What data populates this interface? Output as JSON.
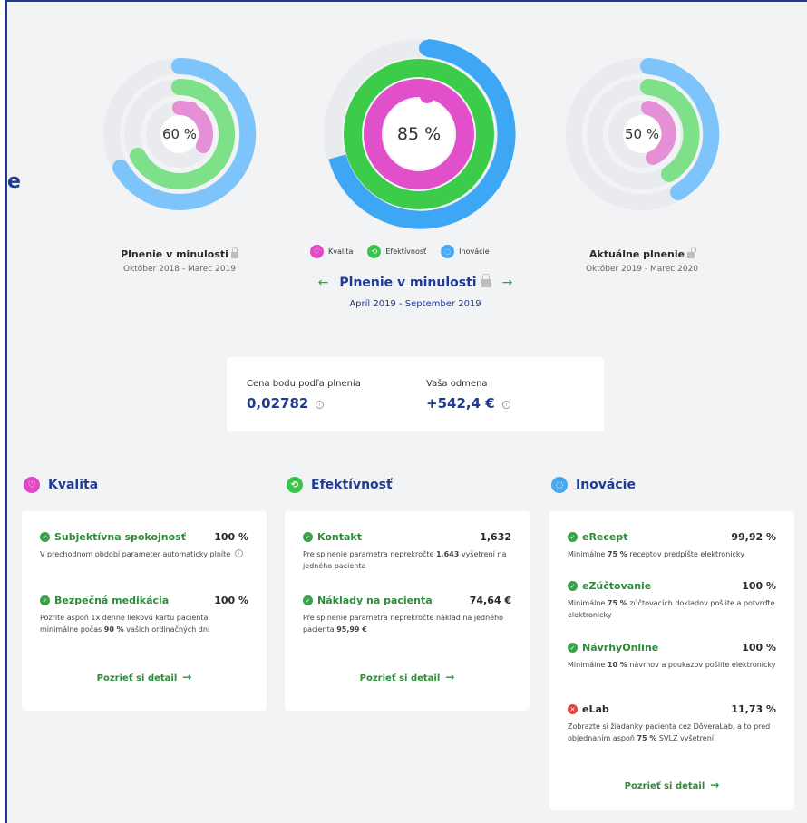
{
  "edge_letter": "e",
  "rings": {
    "left": {
      "percent": "60 %",
      "title": "Plnenie v minulosti",
      "period": "Október 2018 - Marec 2019"
    },
    "center": {
      "percent": "85 %"
    },
    "right": {
      "percent": "50 %",
      "title": "Aktuálne plnenie",
      "period": "Október 2019 - Marec 2020"
    }
  },
  "legend": [
    "Kvalita",
    "Efektívnosť",
    "Inovácie"
  ],
  "nav": {
    "title": "Plnenie v minulosti",
    "period": "Apríl 2019 - September 2019"
  },
  "price": {
    "label": "Cena bodu podľa plnenia",
    "value": "0,02782",
    "reward_label": "Vaša odmena",
    "reward_value": "+542,4 €"
  },
  "sections": {
    "kvalita": {
      "title": "Kvalita",
      "items": [
        {
          "name": "Subjektívna spokojnosť",
          "value": "100 %",
          "desc": "V prechodnom období parameter automaticky plníte"
        },
        {
          "name": "Bezpečná medikácia",
          "value": "100 %",
          "desc_a": "Pozrite aspoň 1x denne liekovú kartu pacienta, minimálne počas ",
          "desc_b": "90 %",
          "desc_c": " vašich ordinačných dní"
        }
      ],
      "detail": "Pozrieť si detail"
    },
    "efektivnost": {
      "title": "Efektívnosť",
      "items": [
        {
          "name": "Kontakt",
          "value": "1,632",
          "desc_a": "Pre splnenie parametra neprekročte ",
          "desc_b": "1,643",
          "desc_c": " vyšetrení na jedného pacienta"
        },
        {
          "name": "Náklady na pacienta",
          "value": "74,64 €",
          "desc_a": "Pre splnenie parametra neprekročte náklad na jedného pacienta ",
          "desc_b": "95,99 €",
          "desc_c": ""
        }
      ],
      "detail": "Pozrieť si detail"
    },
    "inovacie": {
      "title": "Inovácie",
      "items": [
        {
          "name": "eRecept",
          "value": "99,92 %",
          "desc_a": "Minimálne ",
          "desc_b": "75 %",
          "desc_c": " receptov predpíšte elektronicky"
        },
        {
          "name": "eZúčtovanie",
          "value": "100 %",
          "desc_a": "Minimálne ",
          "desc_b": "75 %",
          "desc_c": " zúčtovacích dokladov pošlite a potvrďte elektronicky"
        },
        {
          "name": "NávrhyOnline",
          "value": "100 %",
          "desc_a": "Minimálne ",
          "desc_b": "10 %",
          "desc_c": " návrhov a poukazov pošlite elektronicky"
        },
        {
          "name": "eLab",
          "value": "11,73 %",
          "desc_a": "Zobrazte si žiadanky pacienta cez DôveraLab, a to pred objednaním aspoň ",
          "desc_b": "75 %",
          "desc_c": " SVLZ vyšetrení"
        }
      ],
      "detail": "Pozrieť si detail"
    }
  }
}
